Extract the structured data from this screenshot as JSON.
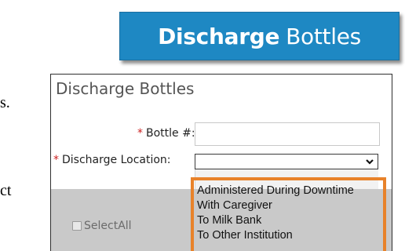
{
  "banner": {
    "title_bold": "Discharge",
    "title_rest": "Bottles"
  },
  "fragments": {
    "line1": "s.",
    "line2": "ct"
  },
  "panel": {
    "title": "Discharge Bottles",
    "bottle_label": "Bottle #:",
    "location_label": "Discharge Location:",
    "required_mark": "*",
    "bottle_value": "",
    "select_all_label": "SelectAll"
  },
  "dropdown": {
    "options": [
      "Administered During Downtime",
      "With Caregiver",
      "To Milk Bank",
      "To Other Institution"
    ]
  },
  "colors": {
    "banner_bg": "#1e88c3",
    "required": "#cc1f1f",
    "highlight": "#e8822a"
  }
}
